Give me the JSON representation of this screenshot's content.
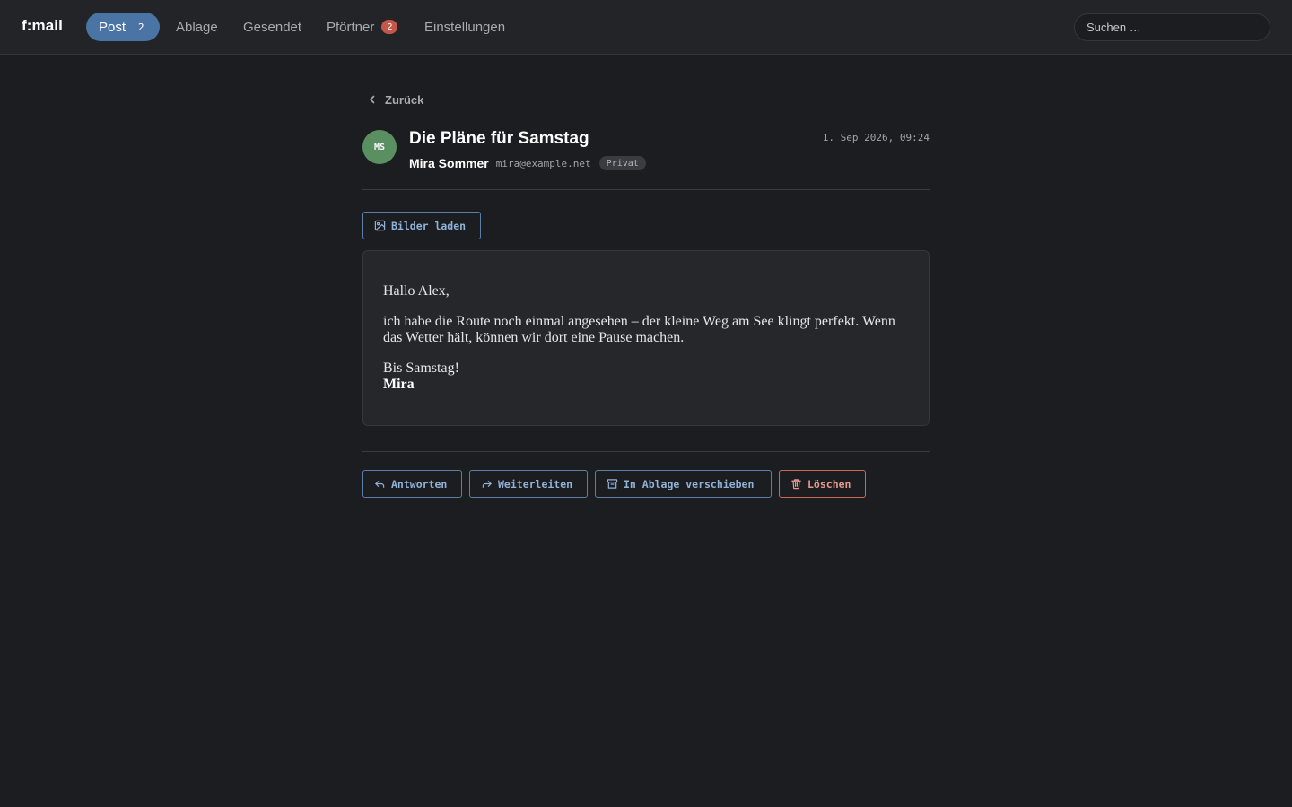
{
  "app": {
    "logo": "f:mail"
  },
  "nav": {
    "post": {
      "label": "Post",
      "count": "2"
    },
    "ablage": {
      "label": "Ablage"
    },
    "gesendet": {
      "label": "Gesendet"
    },
    "pfortner": {
      "label": "Pförtner",
      "badge": "2"
    },
    "einstellungen": {
      "label": "Einstellungen"
    }
  },
  "search": {
    "placeholder": "Suchen …"
  },
  "back": {
    "label": "Zurück"
  },
  "message": {
    "avatar_initials": "MS",
    "subject": "Die Pläne für Samstag",
    "date": "1. Sep 2026, 09:24",
    "sender_name": "Mira Sommer",
    "sender_email": "mira@example.net",
    "tag": "Privat",
    "body": {
      "greeting": "Hallo Alex,",
      "paragraph": "ich habe die Route noch einmal angesehen – der kleine Weg am See klingt perfekt. Wenn das Wetter hält, können wir dort eine Pause machen.",
      "closing": "Bis Samstag!",
      "signature": "Mira"
    }
  },
  "actions": {
    "load_images": "Bilder laden",
    "reply": "Antworten",
    "forward": "Weiterleiten",
    "archive": "In Ablage verschieben",
    "delete": "Löschen"
  },
  "colors": {
    "background": "#1c1d20",
    "topbar": "#232427",
    "accent": "#4a74a3",
    "badge": "#c4574a",
    "avatar": "#5a8f62",
    "danger": "#c76a5c"
  }
}
